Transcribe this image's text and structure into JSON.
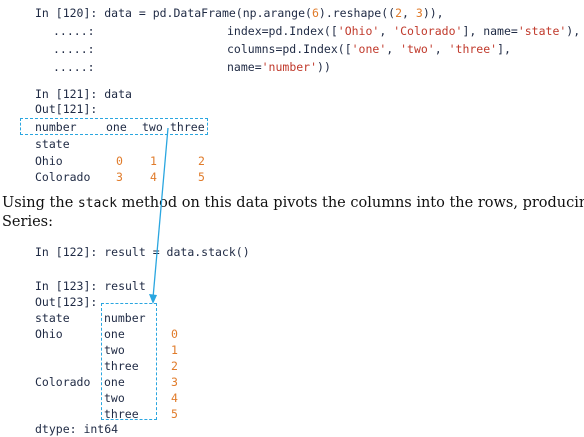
{
  "code_block_1": {
    "in120_prompt": "In [120]: ",
    "in120_code_a": "data = pd.DataFrame(np.arange(",
    "in120_num6": "6",
    "in120_code_b": ").reshape((",
    "in120_num2": "2",
    "in120_code_c": ", ",
    "in120_num3": "3",
    "in120_code_d": ")),",
    "cont_prompt": ".....:",
    "line2_a": "index=pd.Index([",
    "line2_str1": "'Ohio'",
    "line2_b": ", ",
    "line2_str2": "'Colorado'",
    "line2_c": "], name=",
    "line2_str3": "'state'",
    "line2_d": "),",
    "line3_a": "columns=pd.Index([",
    "line3_str1": "'one'",
    "line3_b": ", ",
    "line3_str2": "'two'",
    "line3_c": ", ",
    "line3_str3": "'three'",
    "line3_d": "],",
    "line4_a": "name=",
    "line4_str": "'number'",
    "line4_b": "))"
  },
  "code_block_2": {
    "in121": "In [121]: data",
    "out121": "Out[121]:",
    "header": {
      "index_name": "number",
      "cols": [
        "one",
        "two",
        "three"
      ]
    },
    "row_index_name": "state",
    "rows": [
      {
        "label": "Ohio",
        "values": [
          "0",
          "1",
          "2"
        ]
      },
      {
        "label": "Colorado",
        "values": [
          "3",
          "4",
          "5"
        ]
      }
    ]
  },
  "prose": {
    "line1_a": "Using the ",
    "line1_code": "stack",
    "line1_b": " method on this data pivots the columns into the rows, producing a",
    "line2": "Series:"
  },
  "code_block_3": {
    "in122": "In [122]: result = data.stack()",
    "in123": "In [123]: result",
    "out123": "Out[123]:",
    "col_state": "state",
    "col_number": "number",
    "entries": [
      {
        "state": "Ohio",
        "number": "one",
        "value": "0"
      },
      {
        "state": "",
        "number": "two",
        "value": "1"
      },
      {
        "state": "",
        "number": "three",
        "value": "2"
      },
      {
        "state": "Colorado",
        "number": "one",
        "value": "3"
      },
      {
        "state": "",
        "number": "two",
        "value": "4"
      },
      {
        "state": "",
        "number": "three",
        "value": "5"
      }
    ],
    "dtype": "dtype: int64"
  },
  "colors": {
    "code_text": "#1f2a44",
    "number": "#e07b2a",
    "string": "#c0392b",
    "dashed_box": "#2aa6e0"
  }
}
